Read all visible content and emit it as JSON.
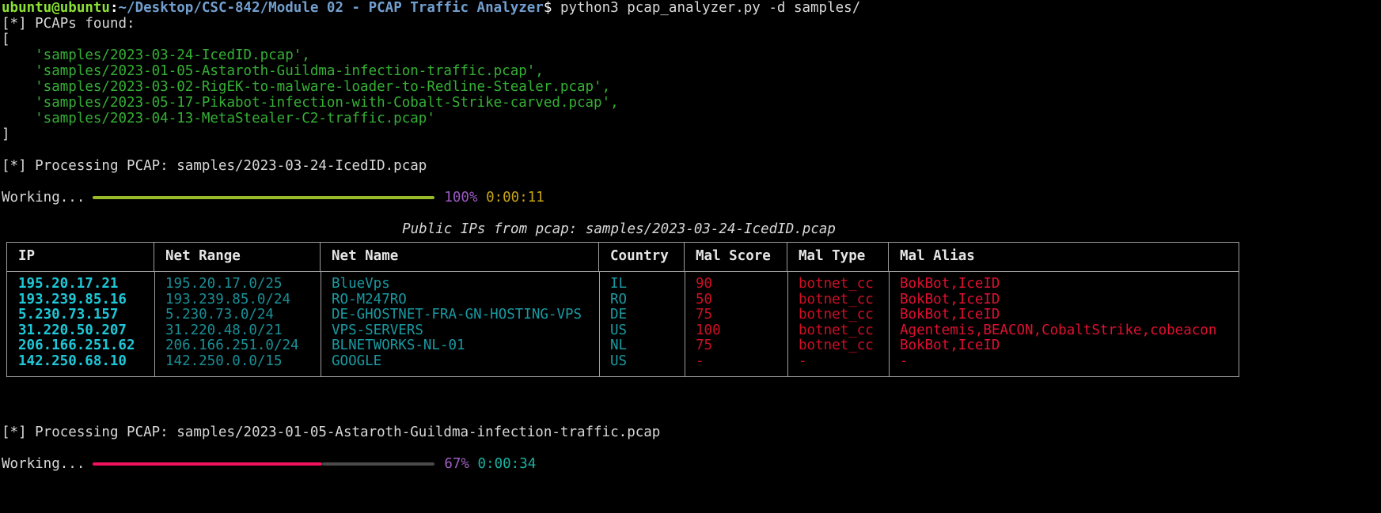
{
  "prompt": {
    "user_host": "ubuntu@ubuntu",
    "separator": ":",
    "path": "~/Desktop/CSC-842/Module 02 - PCAP Traffic Analyzer",
    "dollar": "$",
    "command": " python3 pcap_analyzer.py -d samples/"
  },
  "found_header": "[*] PCAPs found:",
  "list_open": "[",
  "list_close": "]",
  "pcap_files": [
    "    'samples/2023-03-24-IcedID.pcap',",
    "    'samples/2023-01-05-Astaroth-Guildma-infection-traffic.pcap',",
    "    'samples/2023-03-02-RigEK-to-malware-loader-to-Redline-Stealer.pcap',",
    "    'samples/2023-05-17-Pikabot-infection-with-Cobalt-Strike-carved.pcap',",
    "    'samples/2023-04-13-MetaStealer-C2-traffic.pcap'"
  ],
  "job1": {
    "processing_line": "[*] Processing PCAP: samples/2023-03-24-IcedID.pcap",
    "progress_label": "Working...",
    "percent": "100%",
    "elapsed": "0:00:11",
    "percent_value": 100,
    "bar_color": "#9aba2a",
    "bar_track_color": "#4a4a4a"
  },
  "table": {
    "title": "Public IPs from pcap: samples/2023-03-24-IcedID.pcap",
    "columns": [
      "IP",
      "Net Range",
      "Net Name",
      "Country",
      "Mal Score",
      "Mal Type",
      "Mal Alias"
    ],
    "rows": [
      {
        "ip": "195.20.17.21",
        "net_range": "195.20.17.0/25",
        "net_name": "BlueVps",
        "country": "IL",
        "mal_score": "90",
        "mal_type": "botnet_cc",
        "mal_alias": "BokBot,IceID"
      },
      {
        "ip": "193.239.85.16",
        "net_range": "193.239.85.0/24",
        "net_name": "RO-M247RO",
        "country": "RO",
        "mal_score": "50",
        "mal_type": "botnet_cc",
        "mal_alias": "BokBot,IceID"
      },
      {
        "ip": "5.230.73.157",
        "net_range": "5.230.73.0/24",
        "net_name": "DE-GHOSTNET-FRA-GN-HOSTING-VPS",
        "country": "DE",
        "mal_score": "75",
        "mal_type": "botnet_cc",
        "mal_alias": "BokBot,IceID"
      },
      {
        "ip": "31.220.50.207",
        "net_range": "31.220.48.0/21",
        "net_name": "VPS-SERVERS",
        "country": "US",
        "mal_score": "100",
        "mal_type": "botnet_cc",
        "mal_alias": "Agentemis,BEACON,CobaltStrike,cobeacon"
      },
      {
        "ip": "206.166.251.62",
        "net_range": "206.166.251.0/24",
        "net_name": "BLNETWORKS-NL-01",
        "country": "NL",
        "mal_score": "75",
        "mal_type": "botnet_cc",
        "mal_alias": "BokBot,IceID"
      },
      {
        "ip": "142.250.68.10",
        "net_range": "142.250.0.0/15",
        "net_name": "GOOGLE",
        "country": "US",
        "mal_score": "-",
        "mal_type": "-",
        "mal_alias": "-"
      }
    ]
  },
  "job2": {
    "processing_line": "[*] Processing PCAP: samples/2023-01-05-Astaroth-Guildma-infection-traffic.pcap",
    "progress_label": "Working...",
    "percent": "67%",
    "elapsed": "0:00:34",
    "percent_value": 67,
    "bar_color": "#f4125e",
    "bar_track_color": "#4a4a4a"
  }
}
